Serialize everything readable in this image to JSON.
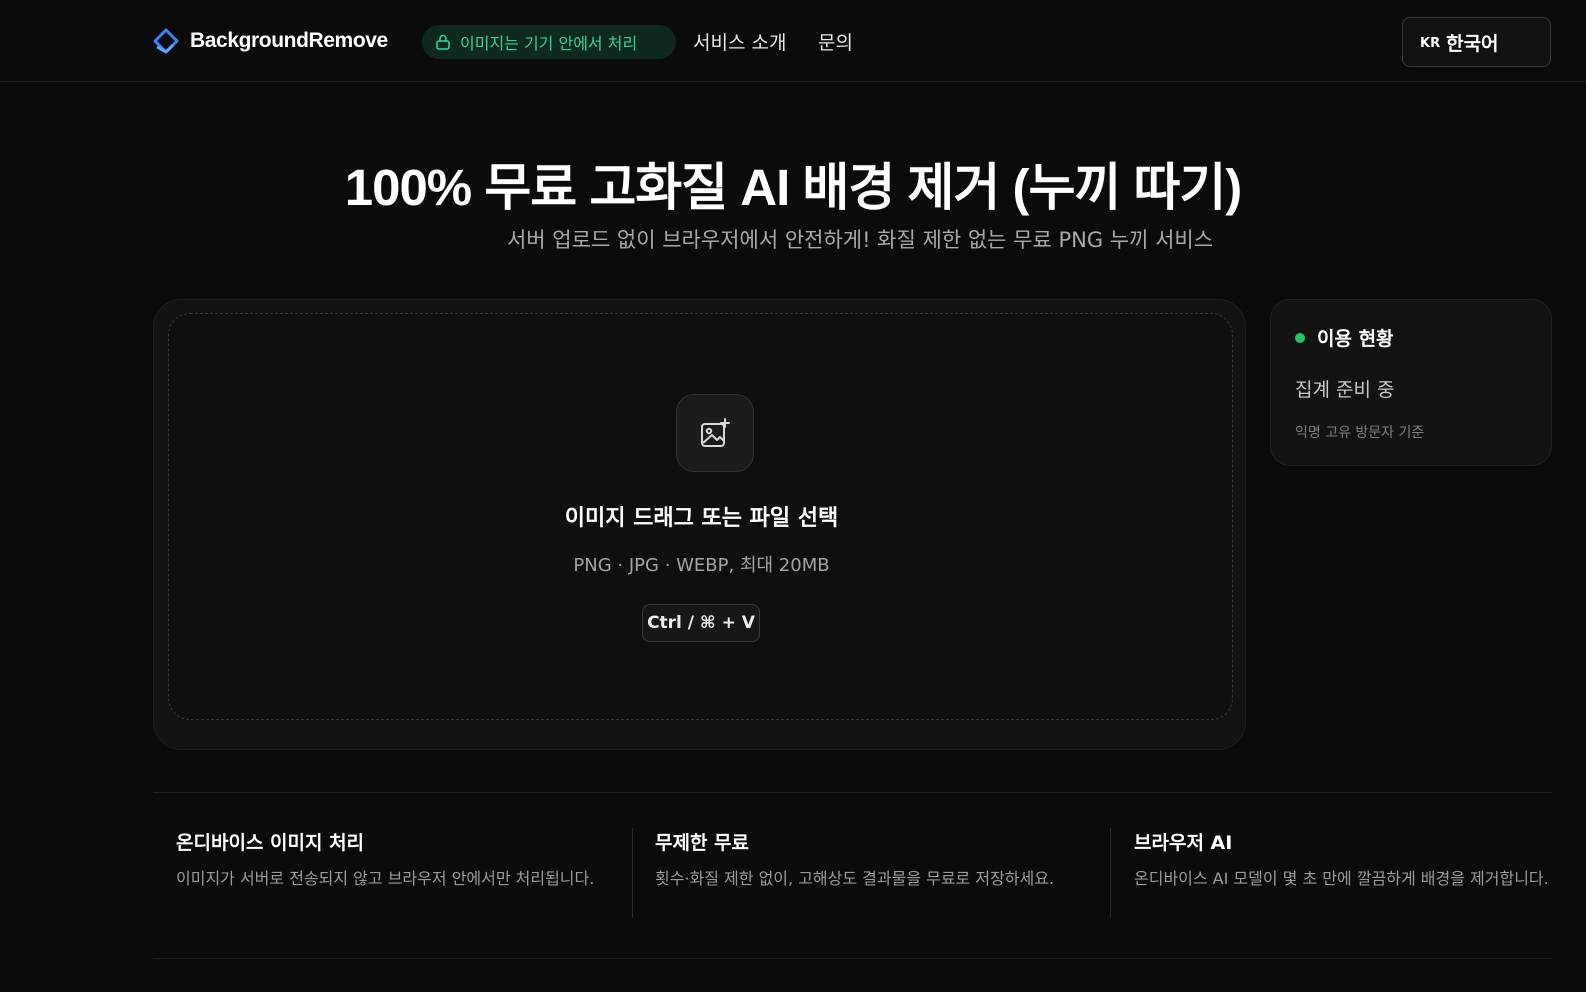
{
  "header": {
    "brand": "BackgroundRemove",
    "brand_icon": "eraser-diamond-icon",
    "brand_color": "#3b82f6",
    "privacy_badge": "이미지는 기기 안에서 처리",
    "privacy_icon": "lock-icon",
    "accent_green": "#34d399",
    "nav": [
      {
        "label": "서비스 소개"
      },
      {
        "label": "문의"
      }
    ],
    "language": {
      "code": "KR",
      "label": "한국어"
    }
  },
  "hero": {
    "title": "100% 무료 고화질 AI 배경 제거 (누끼 따기)",
    "subtitle": "서버 업로드 없이 브라우저에서 안전하게! 화질 제한 없는 무료 PNG 누끼 서비스"
  },
  "upload": {
    "icon": "image-plus-icon",
    "title": "이미지 드래그 또는 파일 선택",
    "formats": "PNG · JPG · WEBP, 최대 20MB",
    "shortcut": "Ctrl / ⌘ + V"
  },
  "stats": {
    "title": "이용 현황",
    "status": "집계 준비 중",
    "note": "익명 고유 방문자 기준",
    "dot_color": "#22c55e"
  },
  "features": [
    {
      "title": "온디바이스 이미지 처리",
      "desc": "이미지가 서버로 전송되지 않고 브라우저 안에서만 처리됩니다."
    },
    {
      "title": "무제한 무료",
      "desc": "횟수·화질 제한 없이, 고해상도 결과물을 무료로 저장하세요."
    },
    {
      "title": "브라우저 AI",
      "desc": "온디바이스 AI 모델이 몇 초 만에 깔끔하게 배경을 제거합니다."
    }
  ]
}
